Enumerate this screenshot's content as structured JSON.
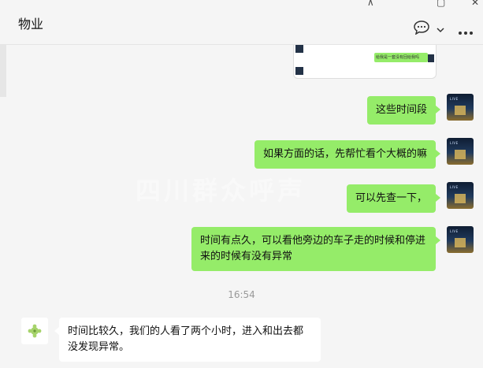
{
  "header": {
    "title": "物业",
    "chat_icon": "chat-bubble-icon",
    "more_icon": "more-icon",
    "window_controls": {
      "pin": "⊼",
      "maximize": "▢",
      "close": "✕"
    }
  },
  "image_card": {
    "mini_text": "给我是一套没有回给我吗"
  },
  "messages": [
    {
      "side": "right",
      "text": "这些时间段"
    },
    {
      "side": "right",
      "text": "如果方面的话，先帮忙看个大概的嘛"
    },
    {
      "side": "right",
      "text": "可以先查一下，"
    },
    {
      "side": "right",
      "text": "时间有点久，可以看他旁边的车子走的时候和停进来的时候有没有异常"
    }
  ],
  "timestamp": "16:54",
  "reply": {
    "side": "left",
    "text": "时间比较久，我们的人看了两个小时，进入和出去都没发现异常。"
  },
  "watermark": "四川群众呼声",
  "colors": {
    "sent_bubble": "#95ec69",
    "received_bubble": "#ffffff",
    "background": "#f5f5f5"
  }
}
